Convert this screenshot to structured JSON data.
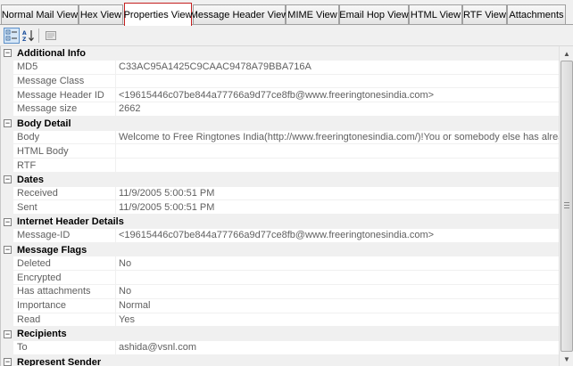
{
  "tabs": [
    {
      "label": "Normal Mail View",
      "active": false
    },
    {
      "label": "Hex View",
      "active": false
    },
    {
      "label": "Properties View",
      "active": true
    },
    {
      "label": "Message Header View",
      "active": false
    },
    {
      "label": "MIME View",
      "active": false
    },
    {
      "label": "Email Hop View",
      "active": false
    },
    {
      "label": "HTML View",
      "active": false
    },
    {
      "label": "RTF View",
      "active": false
    },
    {
      "label": "Attachments",
      "active": false
    }
  ],
  "toolbar": {
    "buttons": [
      {
        "icon": "categorized-icon",
        "pressed": true
      },
      {
        "icon": "sort-alphabetical-icon",
        "pressed": false
      },
      {
        "icon": "property-pages-icon",
        "pressed": false
      }
    ]
  },
  "colors": {
    "active_tab_border": "#c41e1e",
    "category_background": "#f0f0f0",
    "property_text": "#5f5f5f"
  },
  "expander_glyph": "−",
  "scrollbar": {
    "up_glyph": "▲",
    "down_glyph": "▼"
  },
  "categories": [
    {
      "name": "Additional Info",
      "properties": [
        {
          "name": "MD5",
          "value": "C33AC95A1425C9CAAC9478A79BBA716A"
        },
        {
          "name": "Message Class",
          "value": ""
        },
        {
          "name": "Message Header ID",
          "value": "<19615446c07be844a77766a9d77ce8fb@www.freeringtonesindia.com>"
        },
        {
          "name": "Message size",
          "value": "2662"
        }
      ]
    },
    {
      "name": "Body Detail",
      "properties": [
        {
          "name": "Body",
          "value": "Welcome to Free Ringtones India(http://www.freeringtonesindia.com/)!You or somebody else has already used th"
        },
        {
          "name": "HTML Body",
          "value": ""
        },
        {
          "name": "RTF",
          "value": ""
        }
      ]
    },
    {
      "name": "Dates",
      "properties": [
        {
          "name": "Received",
          "value": "11/9/2005 5:00:51 PM"
        },
        {
          "name": "Sent",
          "value": "11/9/2005 5:00:51 PM"
        }
      ]
    },
    {
      "name": "Internet Header Details",
      "properties": [
        {
          "name": "Message-ID",
          "value": "<19615446c07be844a77766a9d77ce8fb@www.freeringtonesindia.com>"
        }
      ]
    },
    {
      "name": "Message Flags",
      "properties": [
        {
          "name": "Deleted",
          "value": "No"
        },
        {
          "name": "Encrypted",
          "value": ""
        },
        {
          "name": "Has attachments",
          "value": "No"
        },
        {
          "name": "Importance",
          "value": "Normal"
        },
        {
          "name": "Read",
          "value": "Yes"
        }
      ]
    },
    {
      "name": "Recipients",
      "properties": [
        {
          "name": "To",
          "value": "ashida@vsnl.com"
        }
      ]
    },
    {
      "name": "Represent Sender",
      "properties": []
    }
  ]
}
